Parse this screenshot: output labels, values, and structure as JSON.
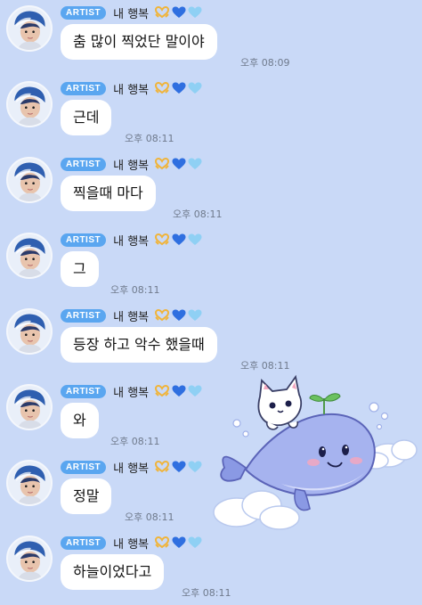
{
  "sender": {
    "badge": "ARTIST",
    "name": "내 행복"
  },
  "messages": [
    {
      "text": "춤 많이 찍었단 말이야",
      "time": "오후 08:09"
    },
    {
      "text": "근데",
      "time": "오후 08:11"
    },
    {
      "text": "찍을때 마다",
      "time": "오후 08:11"
    },
    {
      "text": "그",
      "time": "오후 08:11"
    },
    {
      "text": "등장 하고 악수 했을때",
      "time": "오후 08:11"
    },
    {
      "text": "와",
      "time": "오후 08:11"
    },
    {
      "text": "정말",
      "time": "오후 08:11"
    },
    {
      "text": "하늘이었다고",
      "time": "오후 08:11"
    }
  ],
  "icons": {
    "name_emoji": [
      "heart-hands-icon",
      "blue-heart-icon",
      "light-blue-heart-icon"
    ],
    "sticker": "whale-with-cat-sticker"
  },
  "colors": {
    "background": "#c9d9f7",
    "bubble": "#ffffff",
    "badge": "#5aa6f0",
    "blue_heart": "#2f6fe0",
    "light_blue_heart": "#8fd0f4"
  }
}
